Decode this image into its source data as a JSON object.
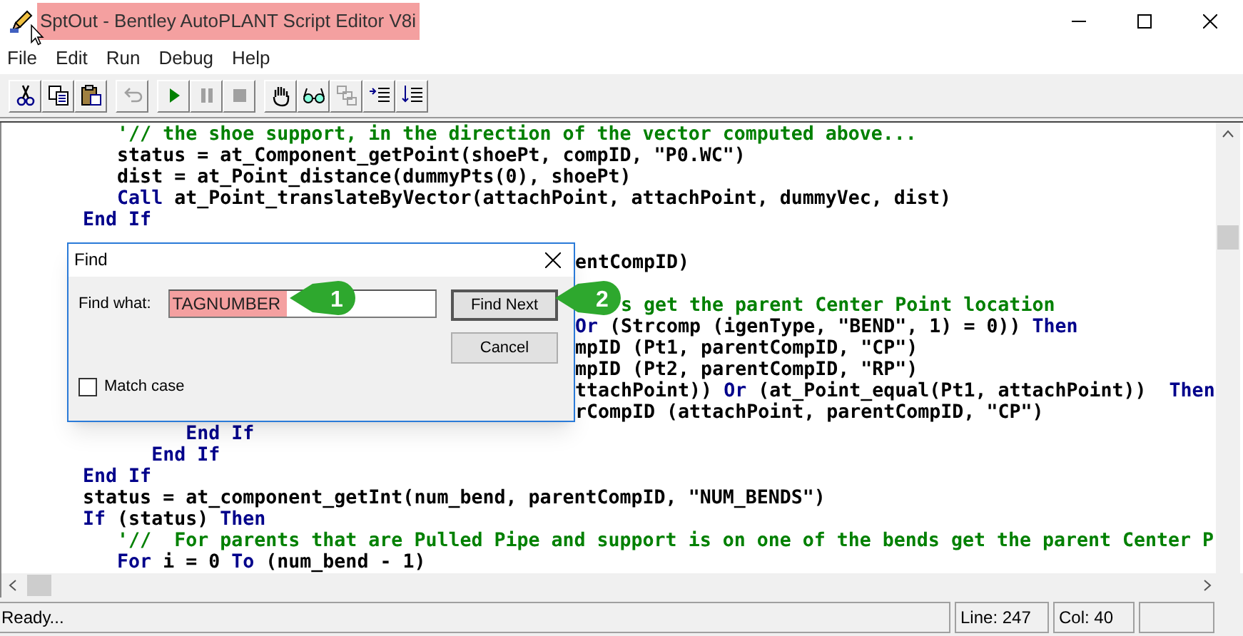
{
  "window": {
    "title": "SptOut - Bentley AutoPLANT Script Editor V8i",
    "title_highlighted": true
  },
  "menu": [
    "File",
    "Edit",
    "Run",
    "Debug",
    "Help"
  ],
  "toolbar": [
    [
      {
        "kind": "cut",
        "disabled": false
      },
      {
        "kind": "copy",
        "disabled": false
      },
      {
        "kind": "paste",
        "disabled": false
      }
    ],
    [
      {
        "kind": "undo",
        "disabled": true
      }
    ],
    [
      {
        "kind": "run",
        "disabled": false
      },
      {
        "kind": "pause",
        "disabled": true
      },
      {
        "kind": "stop",
        "disabled": true
      }
    ],
    [
      {
        "kind": "hand",
        "disabled": false
      },
      {
        "kind": "glasses",
        "disabled": false
      },
      {
        "kind": "stack",
        "disabled": true
      },
      {
        "kind": "indent",
        "disabled": false
      },
      {
        "kind": "outdent",
        "disabled": false
      }
    ]
  ],
  "code_lines": [
    {
      "kind": "full",
      "segments": [
        {
          "kind": "comment",
          "text": "         '// the shoe support, in the direction of the vector computed above..."
        }
      ]
    },
    {
      "kind": "full",
      "segments": [
        {
          "kind": "code",
          "text": "         status = at_Component_getPoint(shoePt, compID, \"P0.WC\")"
        }
      ]
    },
    {
      "kind": "full",
      "segments": [
        {
          "kind": "code",
          "text": "         dist = at_Point_distance(dummyPts(0), shoePt)"
        }
      ]
    },
    {
      "kind": "full",
      "segments": [
        {
          "kind": "keyword",
          "text": "         Call"
        },
        {
          "kind": "code",
          "text": " at_Point_translateByVector(attachPoint, attachPoint, dummyVec, dist)"
        }
      ]
    },
    {
      "kind": "full",
      "segments": [
        {
          "kind": "keyword",
          "text": "      End If"
        }
      ]
    },
    {
      "kind": "blank"
    },
    {
      "kind": "clipped",
      "segments": [
        {
          "kind": "code",
          "text": "entCompID)"
        }
      ]
    },
    {
      "kind": "blank"
    },
    {
      "kind": "clipped_callout",
      "segments": [
        {
          "kind": "comment",
          "text": "s get the parent Center Point location"
        }
      ]
    },
    {
      "kind": "clipped",
      "segments": [
        {
          "kind": "keyword",
          "text": "Or"
        },
        {
          "kind": "code",
          "text": " (Strcomp (igenType, \"BEND\", 1) = 0)) "
        },
        {
          "kind": "keyword",
          "text": "Then"
        }
      ]
    },
    {
      "kind": "clipped",
      "segments": [
        {
          "kind": "code",
          "text": "mpID (Pt1, parentCompID, \"CP\")"
        }
      ]
    },
    {
      "kind": "clipped",
      "segments": [
        {
          "kind": "code",
          "text": "mpID (Pt2, parentCompID, \"RP\")"
        }
      ]
    },
    {
      "kind": "clipped",
      "segments": [
        {
          "kind": "code",
          "text": "ttachPoint)) "
        },
        {
          "kind": "keyword",
          "text": "Or"
        },
        {
          "kind": "code",
          "text": " (at_Point_equal(Pt1, attachPoint))  "
        },
        {
          "kind": "keyword",
          "text": "Then"
        }
      ]
    },
    {
      "kind": "clipped",
      "segments": [
        {
          "kind": "code",
          "text": "rCompID (attachPoint, parentCompID, \"CP\")"
        }
      ]
    },
    {
      "kind": "full",
      "segments": [
        {
          "kind": "keyword",
          "text": "               End If"
        }
      ]
    },
    {
      "kind": "full",
      "segments": [
        {
          "kind": "keyword",
          "text": "            End If"
        }
      ]
    },
    {
      "kind": "full",
      "segments": [
        {
          "kind": "keyword",
          "text": "      End If"
        }
      ]
    },
    {
      "kind": "full",
      "segments": [
        {
          "kind": "code",
          "text": "      status = at_component_getInt(num_bend, parentCompID, \"NUM_BENDS\")"
        }
      ]
    },
    {
      "kind": "full",
      "segments": [
        {
          "kind": "keyword",
          "text": "      If"
        },
        {
          "kind": "code",
          "text": " (status) "
        },
        {
          "kind": "keyword",
          "text": "Then"
        }
      ]
    },
    {
      "kind": "full",
      "segments": [
        {
          "kind": "comment",
          "text": "         '//  For parents that are Pulled Pipe and support is on one of the bends get the parent Center P"
        }
      ]
    },
    {
      "kind": "full",
      "segments": [
        {
          "kind": "keyword",
          "text": "         For"
        },
        {
          "kind": "code",
          "text": " i = 0 "
        },
        {
          "kind": "keyword",
          "text": "To"
        },
        {
          "kind": "code",
          "text": " (num_bend - 1)"
        }
      ]
    }
  ],
  "find_dialog": {
    "title": "Find",
    "label": "Find what:",
    "value": "TAGNUMBER",
    "value_highlighted": true,
    "find_next": "Find Next",
    "cancel": "Cancel",
    "match_case": {
      "label": "Match case",
      "checked": false
    }
  },
  "callouts": [
    {
      "number": "1"
    },
    {
      "number": "2"
    }
  ],
  "status_bar": {
    "message": "Ready...",
    "line": "Line: 247",
    "col": "Col: 40"
  }
}
